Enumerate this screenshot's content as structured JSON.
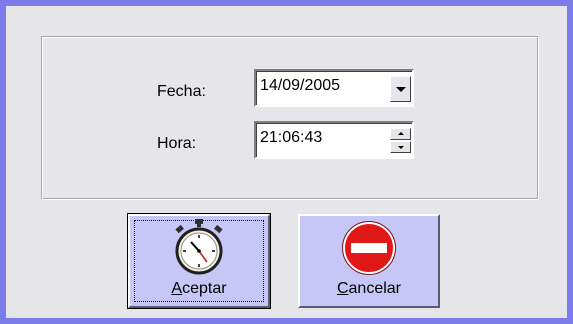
{
  "form": {
    "fecha_label": "Fecha:",
    "fecha_value": "14/09/2005",
    "hora_label": "Hora:",
    "hora_value": "21:06:43"
  },
  "buttons": {
    "accept_first": "A",
    "accept_rest": "ceptar",
    "cancel_first": "C",
    "cancel_rest": "ancelar"
  },
  "colors": {
    "window_border": "#7b7bea",
    "button_face": "#c7c7f7",
    "cancel_red": "#e01818"
  },
  "icons": {
    "accept": "stopwatch-icon",
    "cancel": "no-entry-icon"
  }
}
